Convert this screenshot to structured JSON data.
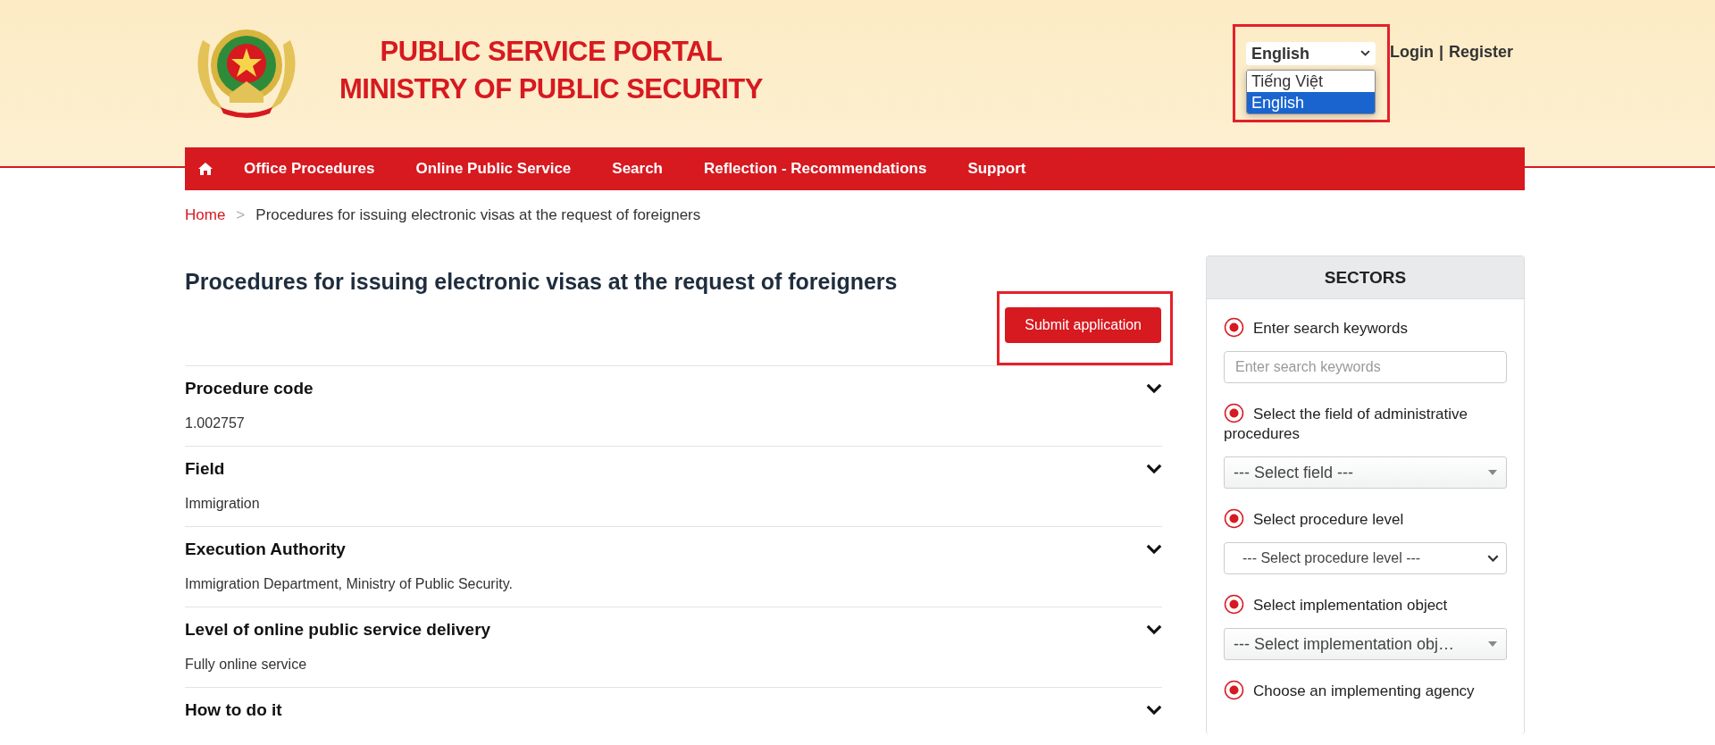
{
  "header": {
    "title_lines": [
      "PUBLIC SERVICE PORTAL",
      "MINISTRY OF PUBLIC SECURITY"
    ],
    "language": {
      "value": "English",
      "options": [
        {
          "label": "Tiếng Việt",
          "selected": false
        },
        {
          "label": "English",
          "selected": true
        }
      ]
    },
    "login": "Login",
    "separator": "|",
    "register": "Register"
  },
  "nav": {
    "items": [
      "Office Procedures",
      "Online Public Service",
      "Search",
      "Reflection - Recommendations",
      "Support"
    ]
  },
  "breadcrumb": {
    "home": "Home",
    "separator": ">",
    "current": "Procedures for issuing electronic visas at the request of foreigners"
  },
  "main": {
    "title": "Procedures for issuing electronic visas at the request of foreigners",
    "submit_button": "Submit application",
    "sections": [
      {
        "heading": "Procedure code",
        "value": "1.002757"
      },
      {
        "heading": "Field",
        "value": "Immigration"
      },
      {
        "heading": "Execution Authority",
        "value": "Immigration Department, Ministry of Public Security."
      },
      {
        "heading": "Level of online public service delivery",
        "value": "Fully online service"
      },
      {
        "heading": "How to do it"
      }
    ]
  },
  "sidebar": {
    "title": "SECTORS",
    "filters": [
      {
        "label": "Enter search keywords",
        "control": {
          "kind": "input",
          "placeholder": "Enter search keywords"
        }
      },
      {
        "label": "Select the field of administrative procedures",
        "control": {
          "kind": "select",
          "value": "--- Select field ---"
        }
      },
      {
        "label": "Select procedure level",
        "control": {
          "kind": "native-select",
          "value": "--- Select procedure level ---"
        }
      },
      {
        "label": "Select implementation object",
        "control": {
          "kind": "select",
          "value": "--- Select implementation obj…"
        }
      },
      {
        "label": "Choose an implementing agency"
      }
    ]
  }
}
